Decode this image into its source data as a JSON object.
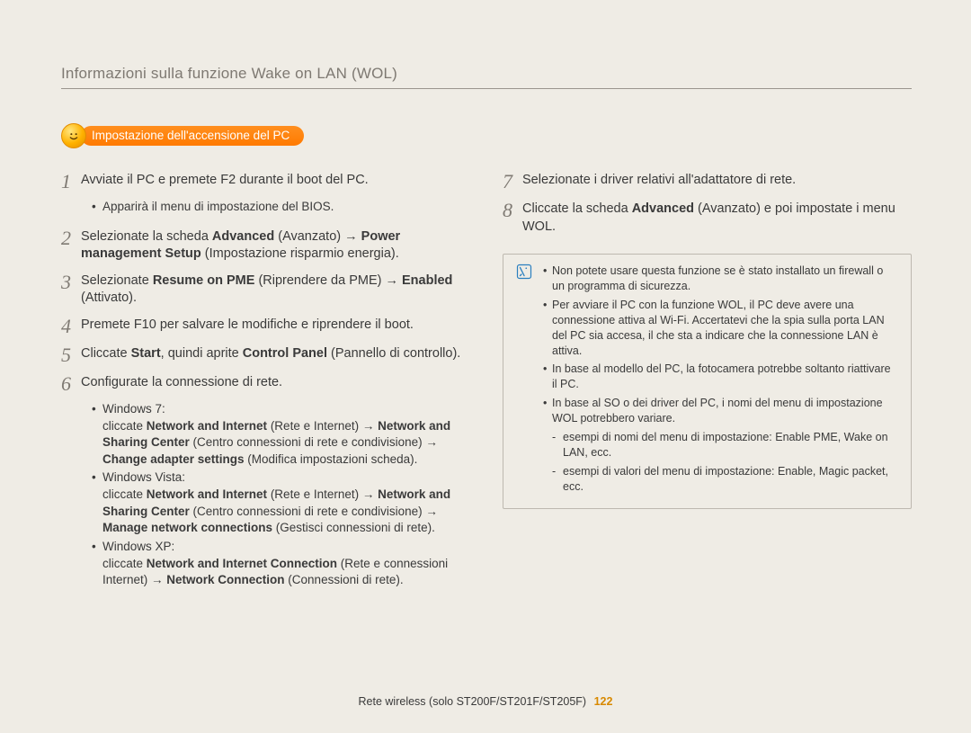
{
  "page_title": "Informazioni sulla funzione Wake on LAN (WOL)",
  "badge_label": "Impostazione dell'accensione del PC",
  "left_steps": [
    {
      "n": "1",
      "html": "Avviate il PC e premete F2 durante il boot del PC.",
      "subs": [
        "Apparirà il menu di impostazione del BIOS."
      ]
    },
    {
      "n": "2",
      "html": "Selezionate la scheda <b>Advanced</b> (Avanzato) → <b>Power management Setup</b> (Impostazione risparmio energia)."
    },
    {
      "n": "3",
      "html": "Selezionate <b>Resume on PME</b> (Riprendere da PME) → <b>Enabled</b> (Attivato)."
    },
    {
      "n": "4",
      "html": "Premete F10 per salvare le modifiche e riprendere il boot."
    },
    {
      "n": "5",
      "html": "Cliccate <b>Start</b>, quindi aprite <b>Control Panel</b> (Pannello di controllo)."
    },
    {
      "n": "6",
      "html": "Configurate la connessione di rete.",
      "subs": [
        "Windows 7:<br>cliccate <b>Network and Internet</b> (Rete e Internet) → <b>Network and Sharing Center</b> (Centro connessioni di rete e condivisione) → <b>Change adapter settings</b> (Modifica impostazioni scheda).",
        "Windows Vista:<br>cliccate <b>Network and Internet</b> (Rete e Internet) → <b>Network and Sharing Center</b> (Centro connessioni di rete e condivisione) → <b>Manage network connections</b> (Gestisci connessioni di rete).",
        "Windows XP:<br>cliccate <b>Network and Internet Connection</b> (Rete e connessioni Internet) → <b>Network Connection</b> (Connessioni di rete)."
      ]
    }
  ],
  "right_steps": [
    {
      "n": "7",
      "html": "Selezionate i driver relativi all'adattatore di rete."
    },
    {
      "n": "8",
      "html": "Cliccate la scheda <b>Advanced</b> (Avanzato) e poi impostate i menu WOL."
    }
  ],
  "notes": [
    "Non potete usare questa funzione se è stato installato un firewall o un programma di sicurezza.",
    "Per avviare il PC con la funzione WOL, il PC deve avere una connessione attiva al Wi-Fi. Accertatevi che la spia sulla porta LAN del PC sia accesa, il che sta a indicare che la connessione LAN è attiva.",
    "In base al modello del PC, la fotocamera potrebbe soltanto riattivare il PC.",
    "In base al SO o dei driver del PC, i nomi del menu di impostazione WOL potrebbero variare."
  ],
  "note_sublist": [
    "esempi di nomi del menu di impostazione: Enable PME, Wake on LAN, ecc.",
    "esempi di valori del menu di impostazione: Enable, Magic packet, ecc."
  ],
  "footer_text": "Rete wireless (solo ST200F/ST201F/ST205F)",
  "page_number": "122"
}
